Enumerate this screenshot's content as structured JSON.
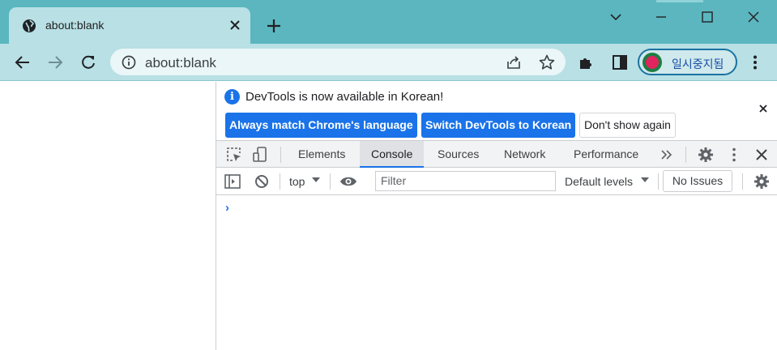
{
  "browser": {
    "tab": {
      "title": "about:blank",
      "favicon": "globe-icon"
    },
    "address": {
      "url": "about:blank"
    },
    "profile": {
      "label": "일시중지됨"
    },
    "colors": {
      "frame": "#5bb6bf",
      "toolbar": "#b8e0e5",
      "omnibox": "#eaf6f7",
      "accent": "#1a73e8"
    }
  },
  "devtools": {
    "infobar": {
      "message": "DevTools is now available in Korean!",
      "buttons": {
        "always_match": "Always match Chrome's language",
        "switch": "Switch DevTools to Korean",
        "dont_show": "Don't show again"
      }
    },
    "tabs": [
      "Elements",
      "Console",
      "Sources",
      "Network",
      "Performance"
    ],
    "active_tab": "Console",
    "console": {
      "context": "top",
      "filter_placeholder": "Filter",
      "levels": "Default levels",
      "issues": "No Issues",
      "prompt": "›"
    }
  }
}
